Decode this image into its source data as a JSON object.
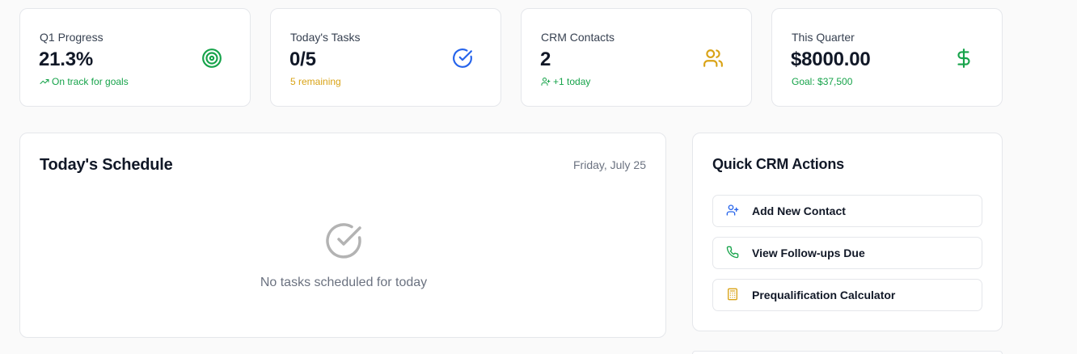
{
  "stats": [
    {
      "label": "Q1 Progress",
      "value": "21.3%",
      "sub": "On track for goals",
      "sub_icon": "trending-up-icon",
      "icon": "target-icon",
      "color": "#16a34a"
    },
    {
      "label": "Today's Tasks",
      "value": "0/5",
      "sub": "5 remaining",
      "icon": "check-circle-icon",
      "color": "#2563eb",
      "sub_color": "#d9a316"
    },
    {
      "label": "CRM Contacts",
      "value": "2",
      "sub": "+1 today",
      "sub_icon": "user-plus-icon",
      "icon": "users-icon",
      "color": "#d9a316",
      "sub_color": "#16a34a"
    },
    {
      "label": "This Quarter",
      "value": "$8000.00",
      "sub": "Goal: $37,500",
      "icon": "dollar-icon",
      "color": "#16a34a",
      "sub_color": "#16a34a"
    }
  ],
  "schedule": {
    "title": "Today's Schedule",
    "date": "Friday, July 25",
    "empty_text": "No tasks scheduled for today"
  },
  "quick_actions": {
    "title": "Quick CRM Actions",
    "items": [
      {
        "label": "Add New Contact",
        "icon": "user-plus-icon",
        "color": "#2563eb"
      },
      {
        "label": "View Follow-ups Due",
        "icon": "phone-icon",
        "color": "#16a34a"
      },
      {
        "label": "Prequalification Calculator",
        "icon": "calculator-icon",
        "color": "#d9a316"
      }
    ]
  }
}
